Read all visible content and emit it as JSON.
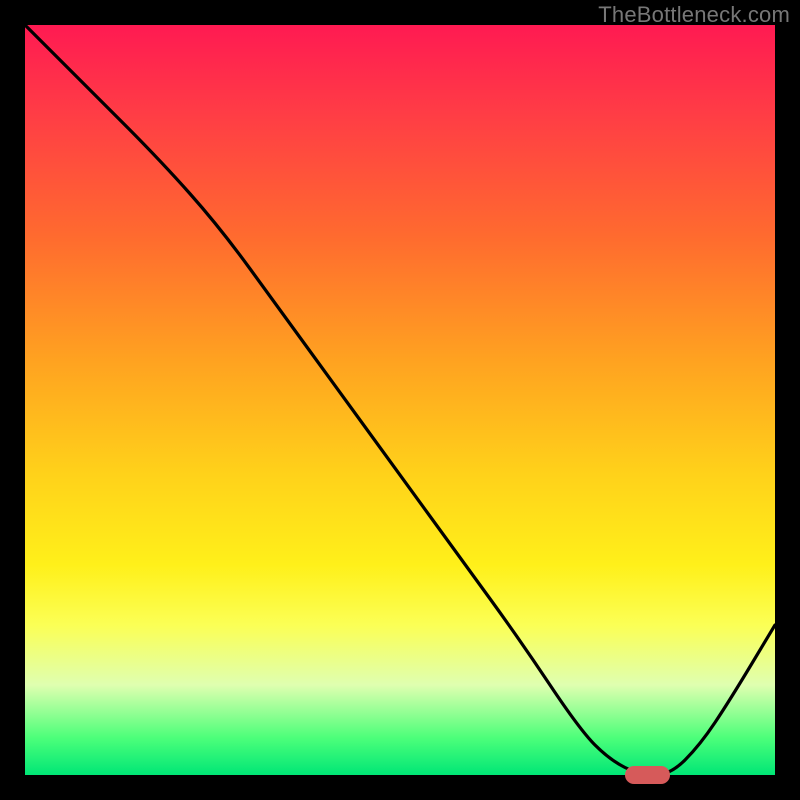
{
  "watermark": "TheBottleneck.com",
  "colors": {
    "background": "#000000",
    "curve": "#000000",
    "marker_fill": "#d65a5a",
    "marker_stroke": "#d65a5a"
  },
  "chart_data": {
    "type": "line",
    "title": "",
    "xlabel": "",
    "ylabel": "",
    "xlim": [
      0,
      100
    ],
    "ylim": [
      0,
      100
    ],
    "series": [
      {
        "name": "bottleneck-curve",
        "x": [
          0,
          8,
          18,
          26,
          34,
          42,
          50,
          58,
          66,
          74,
          78,
          82,
          86,
          90,
          94,
          100
        ],
        "y": [
          100,
          92,
          82,
          73,
          62,
          51,
          40,
          29,
          18,
          6,
          2,
          0,
          0,
          4,
          10,
          20
        ]
      }
    ],
    "marker": {
      "name": "optimal-range",
      "x_start": 80,
      "x_end": 86,
      "y": 0
    },
    "gradient_stops": [
      {
        "pos": 0.0,
        "color": "#ff1a52"
      },
      {
        "pos": 0.12,
        "color": "#ff3d45"
      },
      {
        "pos": 0.28,
        "color": "#ff6a2f"
      },
      {
        "pos": 0.45,
        "color": "#ffa320"
      },
      {
        "pos": 0.6,
        "color": "#ffd21a"
      },
      {
        "pos": 0.72,
        "color": "#fff01a"
      },
      {
        "pos": 0.8,
        "color": "#fbff55"
      },
      {
        "pos": 0.88,
        "color": "#dfffb0"
      },
      {
        "pos": 0.95,
        "color": "#4dff7a"
      },
      {
        "pos": 1.0,
        "color": "#00e676"
      }
    ]
  }
}
